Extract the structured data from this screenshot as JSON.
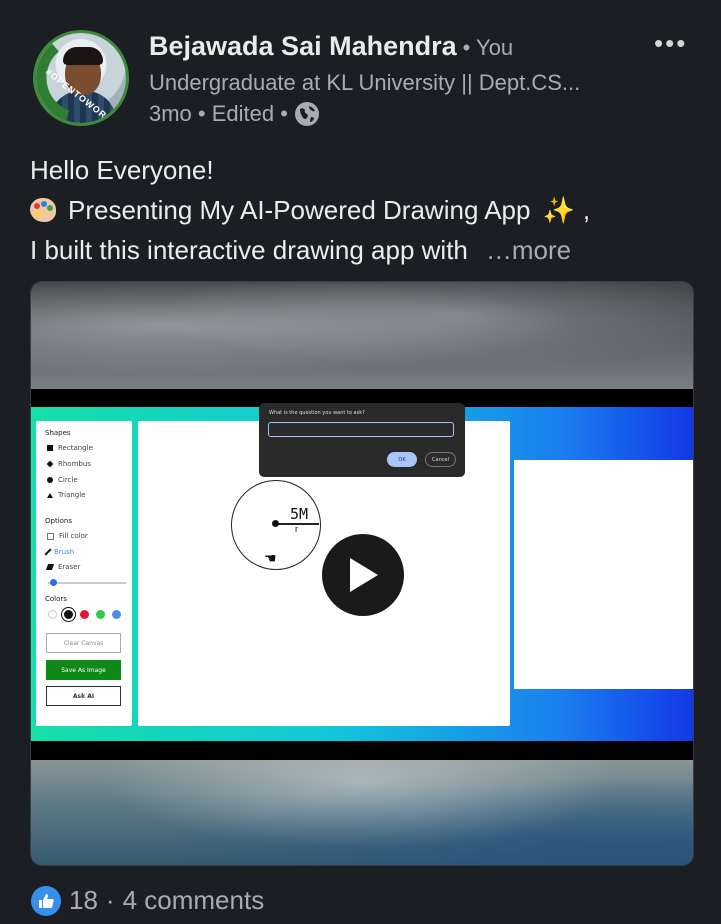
{
  "author": {
    "name": "Bejawada Sai Mahendra",
    "you_label": "• You",
    "headline": "Undergraduate at KL University || Dept.CS...",
    "meta": "3mo • Edited •",
    "avatar_badge": "#OPENTOWORK"
  },
  "post": {
    "line1": "Hello Everyone!",
    "line2": "Presenting My AI-Powered Drawing App",
    "line2_suffix": ",",
    "line3": "I built this interactive drawing app with",
    "more_label": "…more",
    "menu_label": "•••"
  },
  "video_frame": {
    "sidebar": {
      "shapes_heading": "Shapes",
      "shapes": [
        "Rectangle",
        "Rhombus",
        "Circle",
        "Triangle"
      ],
      "options_heading": "Options",
      "options": [
        "Fill color",
        "Brush",
        "Eraser"
      ],
      "colors_heading": "Colors",
      "colors": [
        "#ffffff",
        "#111111",
        "#d81b34",
        "#2ecc40",
        "#4a90e2"
      ],
      "clear_button": "Clear Canvas",
      "save_button": "Save As Image",
      "ask_button": "Ask AI"
    },
    "dialog": {
      "question": "What is the question you want to ask?",
      "ok_label": "OK",
      "cancel_label": "Cancel"
    },
    "handwriting": "5M",
    "handwriting_sub": "r"
  },
  "footer": {
    "reactions_count": "18",
    "separator": "·",
    "comments": "4 comments"
  },
  "colors": {
    "background": "#1b1f23",
    "like_blue": "#378fe9",
    "muted_text": "#a8acb0"
  }
}
